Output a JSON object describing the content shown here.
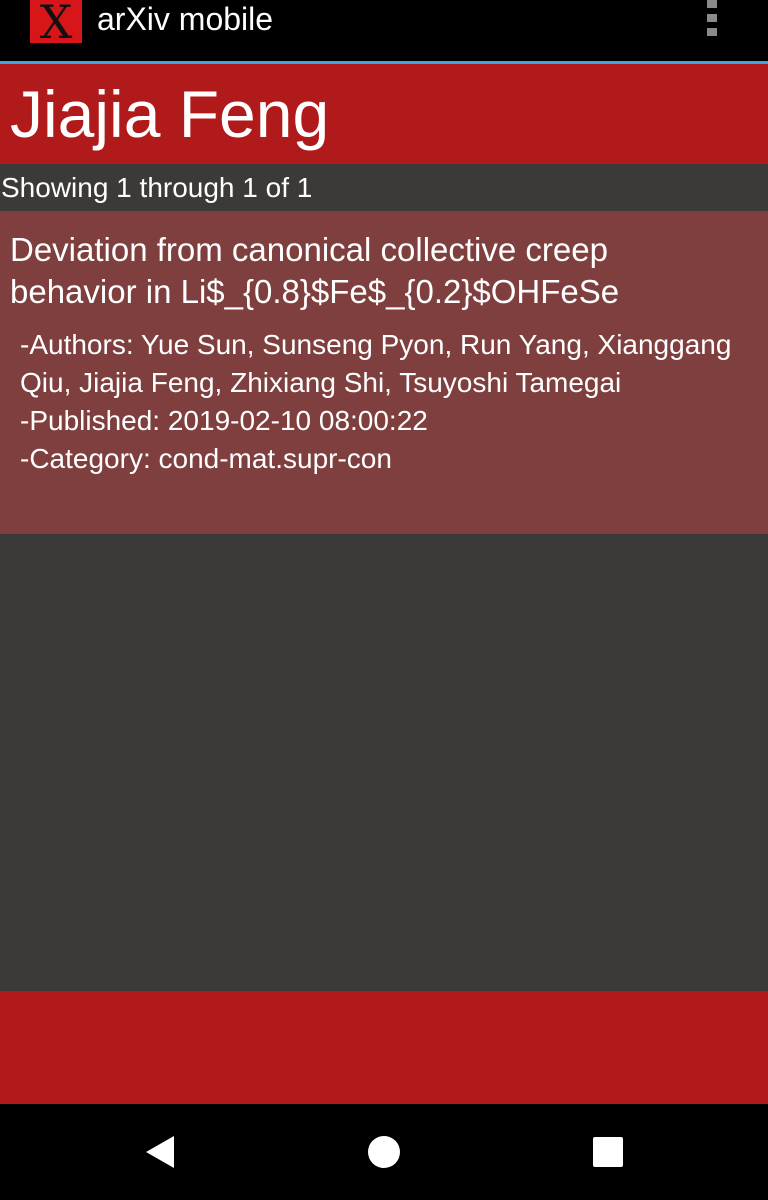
{
  "app_bar": {
    "logo_glyph": "X",
    "title": "arXiv mobile",
    "menu_icon": "overflow-menu-icon"
  },
  "header": {
    "title": "Jiajia Feng"
  },
  "results": {
    "count_text": "Showing 1 through 1 of 1",
    "items": [
      {
        "title": "Deviation from canonical collective creep behavior in Li$_{0.8}$Fe$_{0.2}$OHFeSe",
        "authors": "-Authors: Yue Sun, Sunseng Pyon, Run Yang, Xianggang Qiu, Jiajia Feng, Zhixiang Shi, Tsuyoshi Tamegai",
        "published": "-Published: 2019-02-10 08:00:22",
        "category": "-Category: cond-mat.supr-con"
      }
    ]
  },
  "nav_bar": {
    "back_icon": "back-triangle-icon",
    "home_icon": "home-circle-icon",
    "recents_icon": "recents-square-icon"
  },
  "colors": {
    "brand_red": "#b11a1a",
    "card_red": "#7f3f3f",
    "background": "#3b3a39",
    "accent": "#3da9d6"
  }
}
